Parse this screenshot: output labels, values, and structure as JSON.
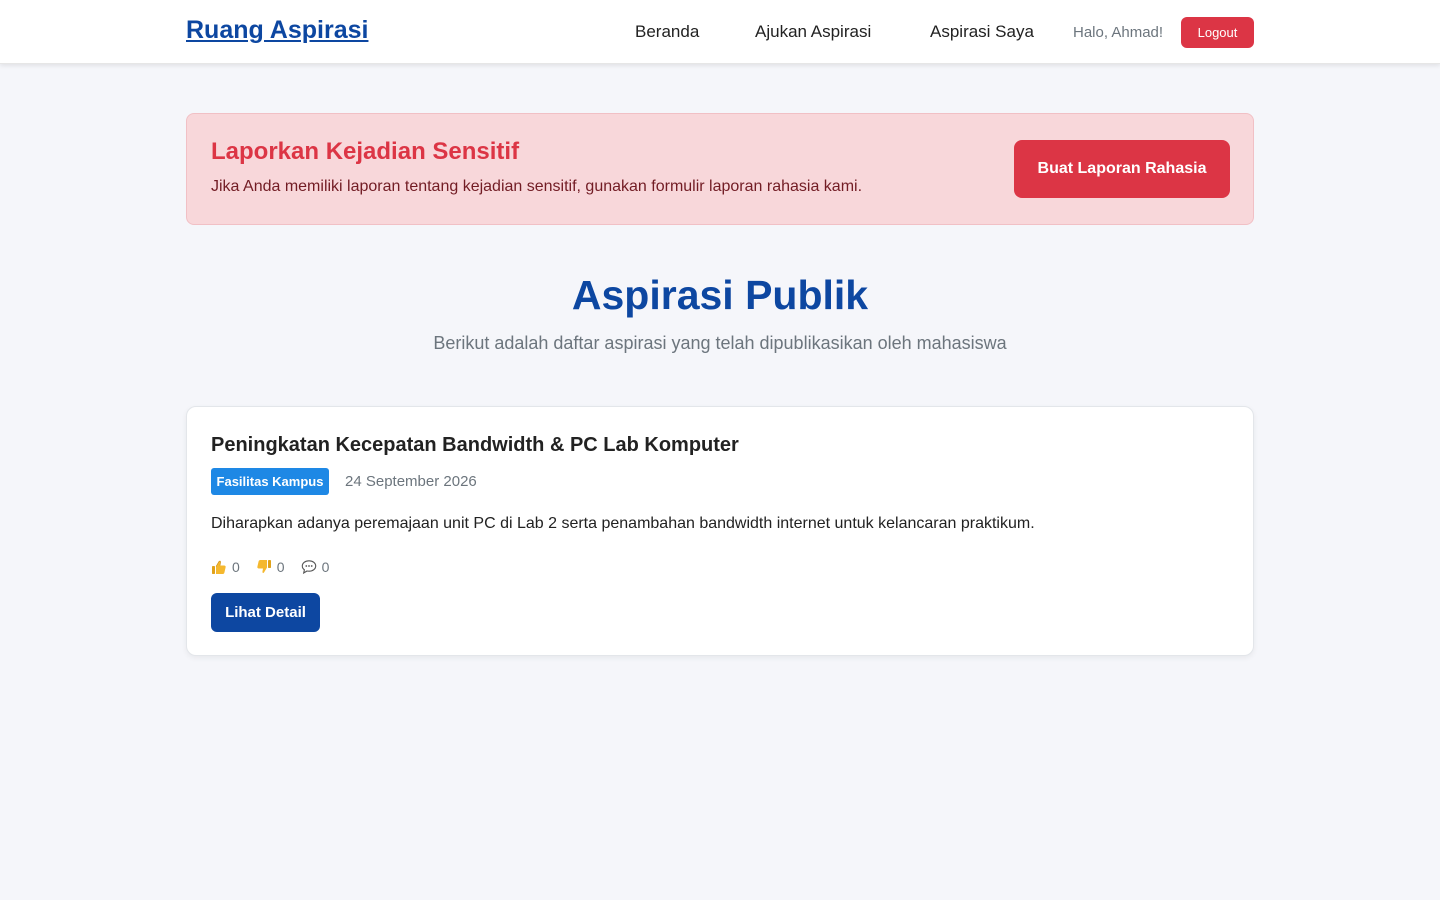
{
  "header": {
    "brand": "Ruang Aspirasi",
    "nav": {
      "beranda": "Beranda",
      "ajukan": "Ajukan Aspirasi",
      "saya": "Aspirasi Saya"
    },
    "greeting": "Halo, Ahmad!",
    "logout_label": "Logout"
  },
  "alert": {
    "title": "Laporkan Kejadian Sensitif",
    "text": "Jika Anda memiliki laporan tentang kejadian sensitif, gunakan formulir laporan rahasia kami.",
    "button_label": "Buat Laporan Rahasia"
  },
  "section": {
    "title": "Aspirasi Publik",
    "subtitle": "Berikut adalah daftar aspirasi yang telah dipublikasikan oleh mahasiswa"
  },
  "aspirations": [
    {
      "title": "Peningkatan Kecepatan Bandwidth & PC Lab Komputer",
      "category": "Fasilitas Kampus",
      "date": "24 September 2026",
      "description": "Diharapkan adanya peremajaan unit PC di Lab 2 serta penambahan bandwidth internet untuk kelancaran praktikum.",
      "likes": "0",
      "dislikes": "0",
      "comments": "0",
      "detail_label": "Lihat Detail"
    }
  ],
  "icons": {
    "like": "thumbs-up-icon",
    "dislike": "thumbs-down-icon",
    "comment": "speech-bubble-icon"
  },
  "colors": {
    "primary": "#0d47a1",
    "danger": "#dc3545",
    "alert_bg": "#f8d7da",
    "badge": "#1e88e5",
    "page_bg": "#f5f6fa"
  }
}
